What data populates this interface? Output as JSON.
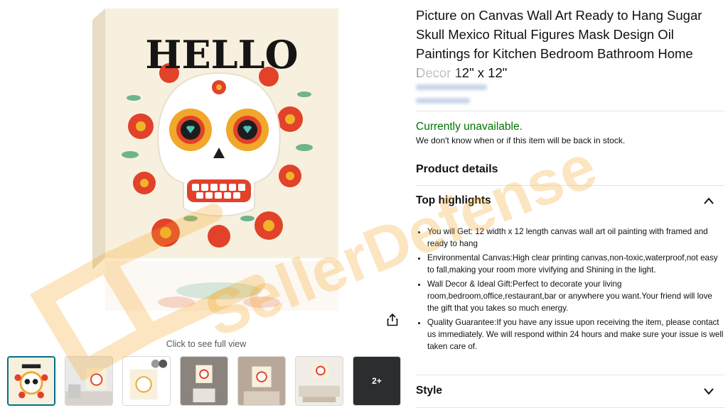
{
  "product": {
    "title": "Picture on Canvas Wall Art Ready to Hang Sugar Skull Mexico Ritual Figures Mask Design Oil Paintings for Kitchen Bedroom Bathroom Home Decor 12\" x 12\"",
    "availability": "Currently unavailable.",
    "availability_note": "We don't know when or if this item will be back in stock."
  },
  "image": {
    "artwork_text": "HELLO",
    "click_to_view": "Click to see full view",
    "more_thumbs_label": "2+",
    "thumbnails": [
      {
        "name": "thumb-1",
        "selected": true
      },
      {
        "name": "thumb-2"
      },
      {
        "name": "thumb-3"
      },
      {
        "name": "thumb-4"
      },
      {
        "name": "thumb-5"
      },
      {
        "name": "thumb-6"
      },
      {
        "name": "thumb-more"
      }
    ]
  },
  "details": {
    "heading": "Product details",
    "top_highlights": {
      "label": "Top highlights",
      "expanded": true,
      "items": [
        "You will Get: 12 width x 12 length canvas wall art oil painting with framed and ready to hang",
        "Environmental Canvas:High clear printing canvas,non-toxic,waterproof,not easy to fall,making your room more vivifying and Shining in the light.",
        "Wall Decor & Ideal Gift:Perfect to decorate your living room,bedroom,office,restaurant,bar or anywhere you want.Your friend will love the gift that you takes so much energy.",
        "Quality Guarantee:If you have any issue upon receiving the item, please contact us immediately. We will respond within 24 hours and make sure your issue is well taken care of."
      ]
    },
    "style": {
      "label": "Style",
      "expanded": false
    }
  },
  "watermark": {
    "text": "SellerDefense",
    "color": "#f5a623"
  },
  "colors": {
    "availability": "#007600",
    "link": "#007185",
    "text": "#0f1111"
  },
  "icons": {
    "share": "share-icon",
    "chevron_up": "chevron-up-icon",
    "chevron_down": "chevron-down-icon"
  }
}
